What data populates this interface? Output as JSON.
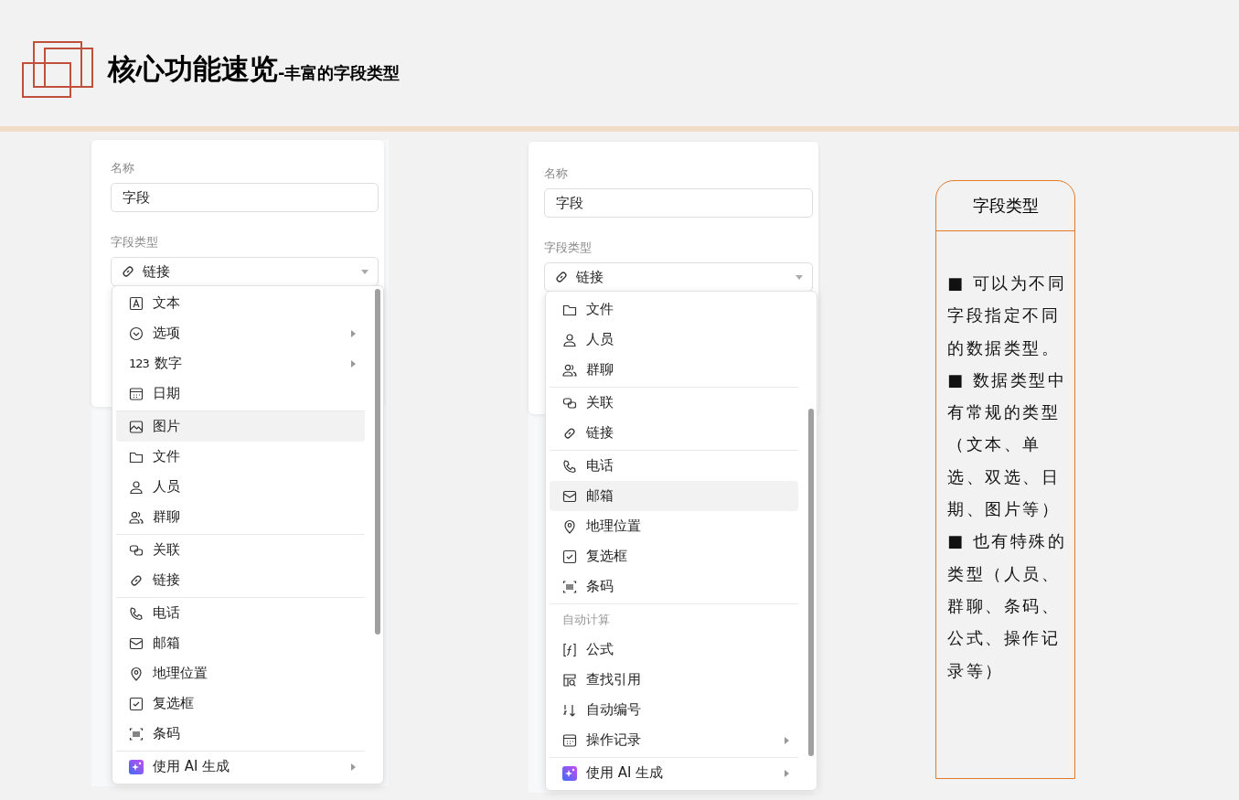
{
  "header": {
    "title": "核心功能速览",
    "subtitle": "-丰富的字段类型"
  },
  "panels": [
    {
      "name_label": "名称",
      "name_value": "字段",
      "type_label": "字段类型",
      "type_value": "链接",
      "menu": [
        {
          "kind": "text",
          "label": "文本",
          "has_submenu": false,
          "selected": false,
          "divider_before": false
        },
        {
          "kind": "select",
          "label": "选项",
          "has_submenu": true,
          "selected": false,
          "divider_before": false
        },
        {
          "kind": "number",
          "icon_text": "123",
          "label": "数字",
          "has_submenu": true,
          "selected": false,
          "divider_before": false
        },
        {
          "kind": "date",
          "label": "日期",
          "has_submenu": false,
          "selected": false,
          "divider_before": false
        },
        {
          "kind": "image",
          "label": "图片",
          "has_submenu": false,
          "selected": true,
          "divider_before": true
        },
        {
          "kind": "file",
          "label": "文件",
          "has_submenu": false,
          "selected": false,
          "divider_before": false
        },
        {
          "kind": "person",
          "label": "人员",
          "has_submenu": false,
          "selected": false,
          "divider_before": false
        },
        {
          "kind": "group",
          "label": "群聊",
          "has_submenu": false,
          "selected": false,
          "divider_before": false
        },
        {
          "kind": "relation",
          "label": "关联",
          "has_submenu": false,
          "selected": false,
          "divider_before": true
        },
        {
          "kind": "link",
          "label": "链接",
          "has_submenu": false,
          "selected": false,
          "divider_before": false
        },
        {
          "kind": "phone",
          "label": "电话",
          "has_submenu": false,
          "selected": false,
          "divider_before": true
        },
        {
          "kind": "email",
          "label": "邮箱",
          "has_submenu": false,
          "selected": false,
          "divider_before": false
        },
        {
          "kind": "location",
          "label": "地理位置",
          "has_submenu": false,
          "selected": false,
          "divider_before": false
        },
        {
          "kind": "checkbox",
          "label": "复选框",
          "has_submenu": false,
          "selected": false,
          "divider_before": false
        },
        {
          "kind": "barcode",
          "label": "条码",
          "has_submenu": false,
          "selected": false,
          "divider_before": false
        },
        {
          "kind": "ai",
          "label": "使用 AI 生成",
          "has_submenu": true,
          "selected": false,
          "divider_before": true
        }
      ]
    },
    {
      "name_label": "名称",
      "name_value": "字段",
      "type_label": "字段类型",
      "type_value": "链接",
      "menu": [
        {
          "kind": "file",
          "label": "文件",
          "has_submenu": false,
          "selected": false,
          "divider_before": false
        },
        {
          "kind": "person",
          "label": "人员",
          "has_submenu": false,
          "selected": false,
          "divider_before": false
        },
        {
          "kind": "group",
          "label": "群聊",
          "has_submenu": false,
          "selected": false,
          "divider_before": false
        },
        {
          "kind": "relation",
          "label": "关联",
          "has_submenu": false,
          "selected": false,
          "divider_before": true
        },
        {
          "kind": "link",
          "label": "链接",
          "has_submenu": false,
          "selected": false,
          "divider_before": false
        },
        {
          "kind": "phone",
          "label": "电话",
          "has_submenu": false,
          "selected": false,
          "divider_before": true
        },
        {
          "kind": "email",
          "label": "邮箱",
          "has_submenu": false,
          "selected": true,
          "divider_before": false
        },
        {
          "kind": "location",
          "label": "地理位置",
          "has_submenu": false,
          "selected": false,
          "divider_before": false
        },
        {
          "kind": "checkbox",
          "label": "复选框",
          "has_submenu": false,
          "selected": false,
          "divider_before": false
        },
        {
          "kind": "barcode",
          "label": "条码",
          "has_submenu": false,
          "selected": false,
          "divider_before": false
        },
        {
          "kind": "heading",
          "label": "自动计算",
          "divider_before": true
        },
        {
          "kind": "formula",
          "label": "公式",
          "has_submenu": false,
          "selected": false,
          "divider_before": false
        },
        {
          "kind": "lookup",
          "label": "查找引用",
          "has_submenu": false,
          "selected": false,
          "divider_before": false
        },
        {
          "kind": "autonumber",
          "label": "自动编号",
          "has_submenu": false,
          "selected": false,
          "divider_before": false
        },
        {
          "kind": "log",
          "label": "操作记录",
          "has_submenu": true,
          "selected": false,
          "divider_before": false
        },
        {
          "kind": "ai",
          "label": "使用 AI 生成",
          "has_submenu": true,
          "selected": false,
          "divider_before": true
        }
      ]
    }
  ],
  "legend": {
    "heading": "字段类型",
    "bullets": [
      "■ 可以为不同字段指定不同的数据类型。",
      "■ 数据类型中有常规的类型（文本、单选、双选、日期、图片等）",
      "■ 也有特殊的类型（人员、群聊、条码、公式、操作记录等）"
    ]
  }
}
